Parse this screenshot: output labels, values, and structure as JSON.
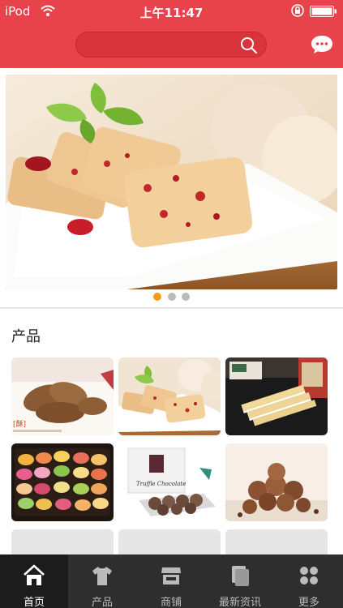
{
  "status_bar": {
    "carrier": "iPod",
    "time": "上午11:47"
  },
  "header": {
    "search_icon": "search-icon",
    "chat_icon": "chat-bubble-icon"
  },
  "banner": {
    "image": "cranberry cookies with eggs on white plate",
    "dots_total": 3,
    "active_dot": 1
  },
  "products": {
    "title": "产品",
    "brand_tag": "[酥]",
    "chocolate_label": "Truffle Chocolate",
    "items": [
      "product-pastry-twists",
      "product-cranberry-cookies",
      "product-sandwich-biscuits",
      "product-macarons",
      "product-truffle-box",
      "product-cocoa-truffles"
    ]
  },
  "tab_bar": {
    "tabs": [
      {
        "label": "首页",
        "icon": "home-icon",
        "active": true
      },
      {
        "label": "产品",
        "icon": "tshirt-icon",
        "active": false
      },
      {
        "label": "商铺",
        "icon": "store-icon",
        "active": false
      },
      {
        "label": "最新资讯",
        "icon": "news-icon",
        "active": false
      },
      {
        "label": "更多",
        "icon": "grid-icon",
        "active": false
      }
    ]
  },
  "colors": {
    "brand_red": "#e8424b",
    "tab_bar_bg": "#2e2e2e",
    "active_dot": "#f59a1a"
  }
}
